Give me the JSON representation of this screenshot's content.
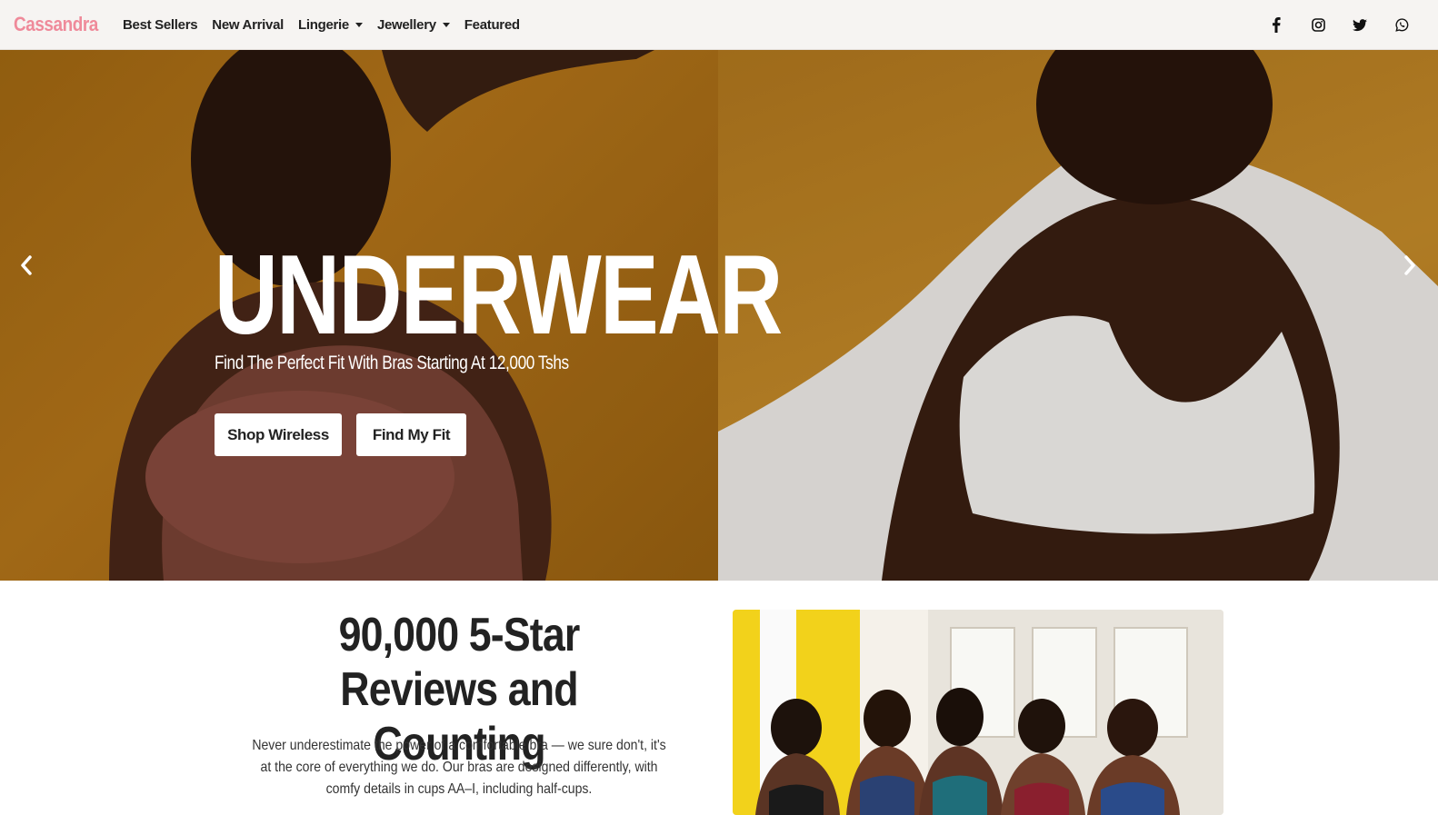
{
  "navbar": {
    "brand": "Cassandra",
    "links": [
      {
        "label": "Best Sellers",
        "dropdown": false
      },
      {
        "label": "New Arrival",
        "dropdown": false
      },
      {
        "label": "Lingerie",
        "dropdown": true
      },
      {
        "label": "Jewellery",
        "dropdown": true
      },
      {
        "label": "Featured",
        "dropdown": false
      }
    ],
    "social_icons": [
      "facebook-icon",
      "instagram-icon",
      "twitter-icon",
      "whatsapp-icon"
    ]
  },
  "hero": {
    "title": "UNDERWEAR",
    "subtitle": "Find The Perfect Fit With Bras Starting At 12,000 Tshs",
    "buttons": {
      "shop_wireless": "Shop Wireless",
      "find_my_fit": "Find My Fit"
    }
  },
  "reviews": {
    "title_line1": "90,000 5-Star",
    "title_line2": "Reviews and Counting",
    "text": "Never underestimate the power of a comfortable bra — we sure don't, it's at the core of everything we do. Our bras are designed differently, with comfy details in cups AA–I, including half-cups."
  },
  "colors": {
    "brand": "#ef8a9a",
    "hero_background": "#b07212",
    "navbar_background": "#f6f4f2"
  }
}
